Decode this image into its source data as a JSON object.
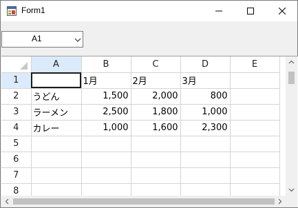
{
  "window": {
    "title": "Form1"
  },
  "name_box": {
    "value": "A1"
  },
  "sheet": {
    "columns": [
      "A",
      "B",
      "C",
      "D",
      "E"
    ],
    "rows": [
      {
        "num": "1",
        "cells": [
          "",
          "1月",
          "2月",
          "3月",
          ""
        ]
      },
      {
        "num": "2",
        "cells": [
          "うどん",
          "1,500",
          "2,000",
          "800",
          ""
        ]
      },
      {
        "num": "3",
        "cells": [
          "ラーメン",
          "2,500",
          "1,800",
          "1,000",
          ""
        ]
      },
      {
        "num": "4",
        "cells": [
          "カレー",
          "1,000",
          "1,600",
          "2,300",
          ""
        ]
      },
      {
        "num": "5",
        "cells": [
          "",
          "",
          "",
          "",
          ""
        ]
      },
      {
        "num": "6",
        "cells": [
          "",
          "",
          "",
          "",
          ""
        ]
      },
      {
        "num": "7",
        "cells": [
          "",
          "",
          "",
          "",
          ""
        ]
      },
      {
        "num": "8",
        "cells": [
          "",
          "",
          "",
          "",
          ""
        ]
      }
    ]
  },
  "colors": {
    "selected_header": "#dcebfc",
    "grid_line": "#d4d4d4",
    "active_border": "#1a1a1a"
  }
}
